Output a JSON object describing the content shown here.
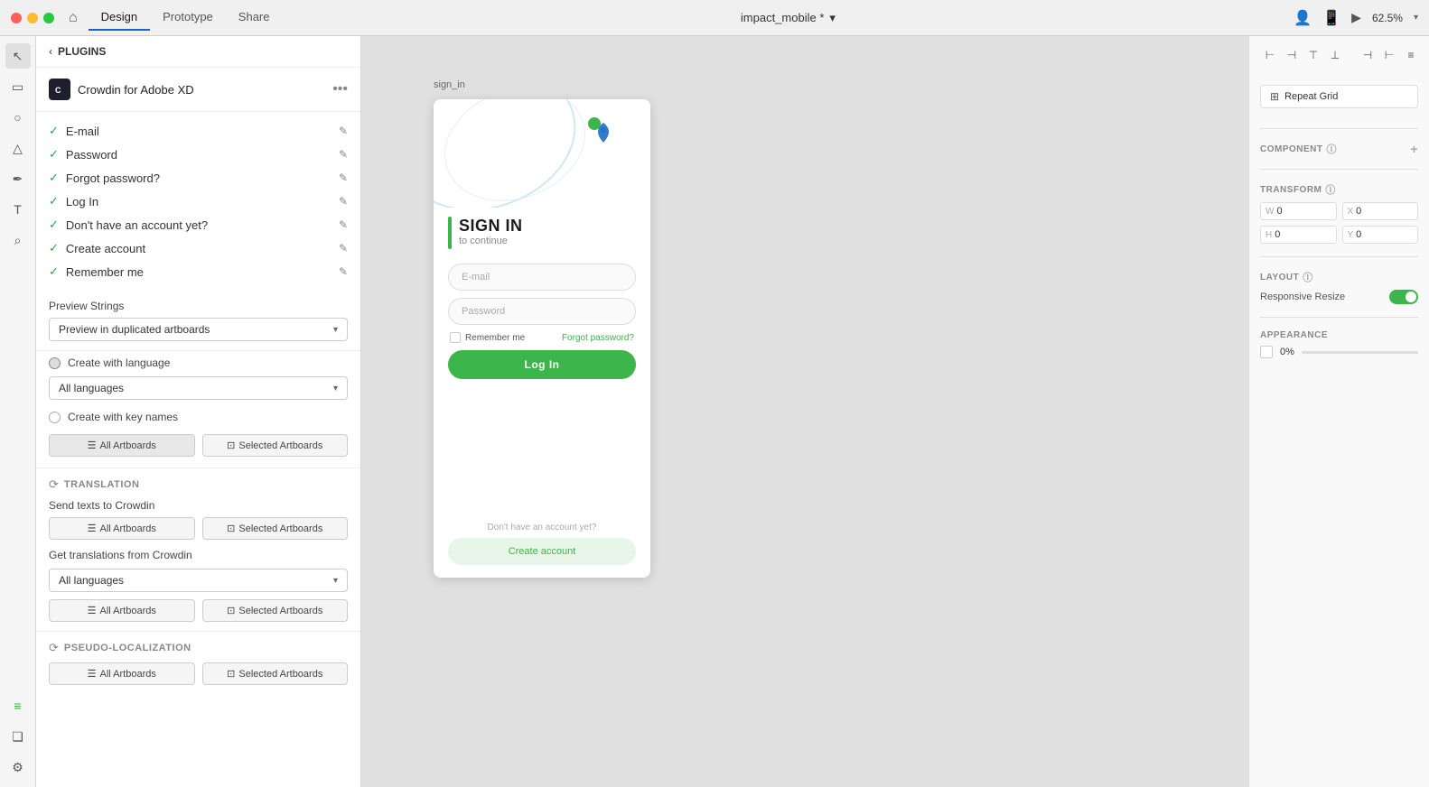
{
  "titlebar": {
    "tabs": [
      "Design",
      "Prototype",
      "Share"
    ],
    "active_tab": "Design",
    "file_name": "impact_mobile *",
    "zoom": "62.5%"
  },
  "left_panel": {
    "header": "PLUGINS",
    "plugin_name": "Crowdin for Adobe XD",
    "strings": [
      {
        "label": "E-mail",
        "checked": true
      },
      {
        "label": "Password",
        "checked": true
      },
      {
        "label": "Forgot password?",
        "checked": true
      },
      {
        "label": "Log In",
        "checked": true
      },
      {
        "label": "Don't have an account yet?",
        "checked": true
      },
      {
        "label": "Create account",
        "checked": true
      },
      {
        "label": "Remember me",
        "checked": true
      }
    ],
    "preview_strings_label": "Preview Strings",
    "preview_dropdown": "Preview in duplicated artboards",
    "create_with_language_label": "Create with language",
    "all_languages_1": "All languages",
    "create_with_key_names_label": "Create with key names",
    "all_artboards_1": "All Artboards",
    "selected_artboards_1": "Selected Artboards",
    "translation_label": "TRANSLATION",
    "send_texts_label": "Send texts to Crowdin",
    "all_artboards_2": "All Artboards",
    "selected_artboards_2": "Selected Artboards",
    "get_translations_label": "Get translations from Crowdin",
    "all_languages_2": "All languages",
    "all_artboards_3": "All Artboards",
    "selected_artboards_3": "Selected Artboards",
    "pseudo_label": "Pseudo-localization",
    "all_artboards_4": "All Artboards",
    "selected_artboards_4": "Selected Artboards"
  },
  "artboard": {
    "label": "sign_in",
    "sign_in_title": "SIGN IN",
    "sign_in_sub": "to continue",
    "email_placeholder": "E-mail",
    "password_placeholder": "Password",
    "remember_me": "Remember me",
    "forgot_password": "Forgot password?",
    "log_in": "Log In",
    "dont_have": "Don't have an account yet?",
    "create_account": "Create account"
  },
  "right_panel": {
    "component_label": "COMPONENT",
    "transform_label": "TRANSFORM",
    "w_label": "W",
    "w_val": "0",
    "x_label": "X",
    "x_val": "0",
    "h_label": "H",
    "h_val": "0",
    "y_label": "Y",
    "y_val": "0",
    "layout_label": "LAYOUT",
    "responsive_resize": "Responsive Resize",
    "appearance_label": "APPEARANCE",
    "opacity": "0%"
  },
  "icons": {
    "back_arrow": "‹",
    "check": "✓",
    "pencil": "✎",
    "chevron_down": "▾",
    "info": "ⓘ",
    "plus": "+",
    "crowdin_letter": "C",
    "ellipsis": "…",
    "home": "⌂",
    "arrow_select": "↖",
    "rect_tool": "▭",
    "ellipse_tool": "○",
    "pen_tool": "✒",
    "text_tool": "T",
    "search_tool": "⌕",
    "layers_icon": "≡",
    "assets_icon": "❏",
    "plugins_icon": "⚙",
    "share_icon": "↑",
    "circle_badges_bottom": "●"
  }
}
